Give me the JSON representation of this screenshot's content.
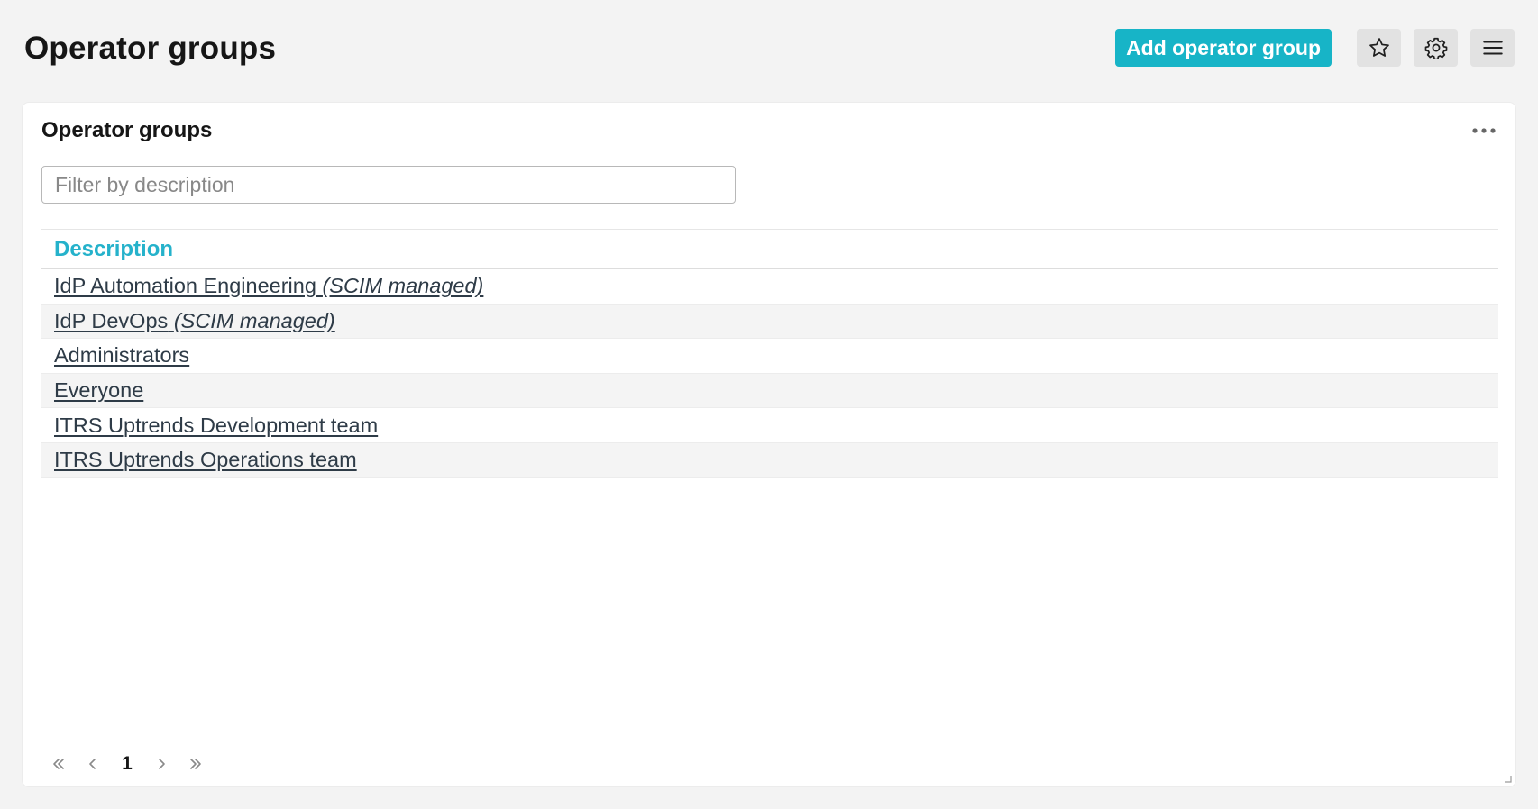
{
  "header": {
    "title": "Operator groups",
    "add_button": "Add operator group",
    "icons": [
      "star-icon",
      "gear-icon",
      "hamburger-menu-icon"
    ]
  },
  "panel": {
    "title": "Operator groups",
    "menu_icon": "more-horizontal-icon",
    "filter": {
      "placeholder": "Filter by description",
      "value": ""
    },
    "table": {
      "columns": [
        "Description"
      ],
      "rows": [
        {
          "label": "IdP Automation Engineering",
          "note": "(SCIM managed)"
        },
        {
          "label": "IdP DevOps",
          "note": "(SCIM managed)"
        },
        {
          "label": "Administrators",
          "note": ""
        },
        {
          "label": "Everyone",
          "note": ""
        },
        {
          "label": "ITRS Uptrends Development team",
          "note": ""
        },
        {
          "label": "ITRS Uptrends Operations team",
          "note": ""
        }
      ]
    },
    "pagination": {
      "current_page": "1"
    }
  },
  "colors": {
    "accent": "#17b4c7",
    "header_link": "#25b2cb",
    "row_link": "#2e3b47",
    "background": "#f3f3f3"
  }
}
